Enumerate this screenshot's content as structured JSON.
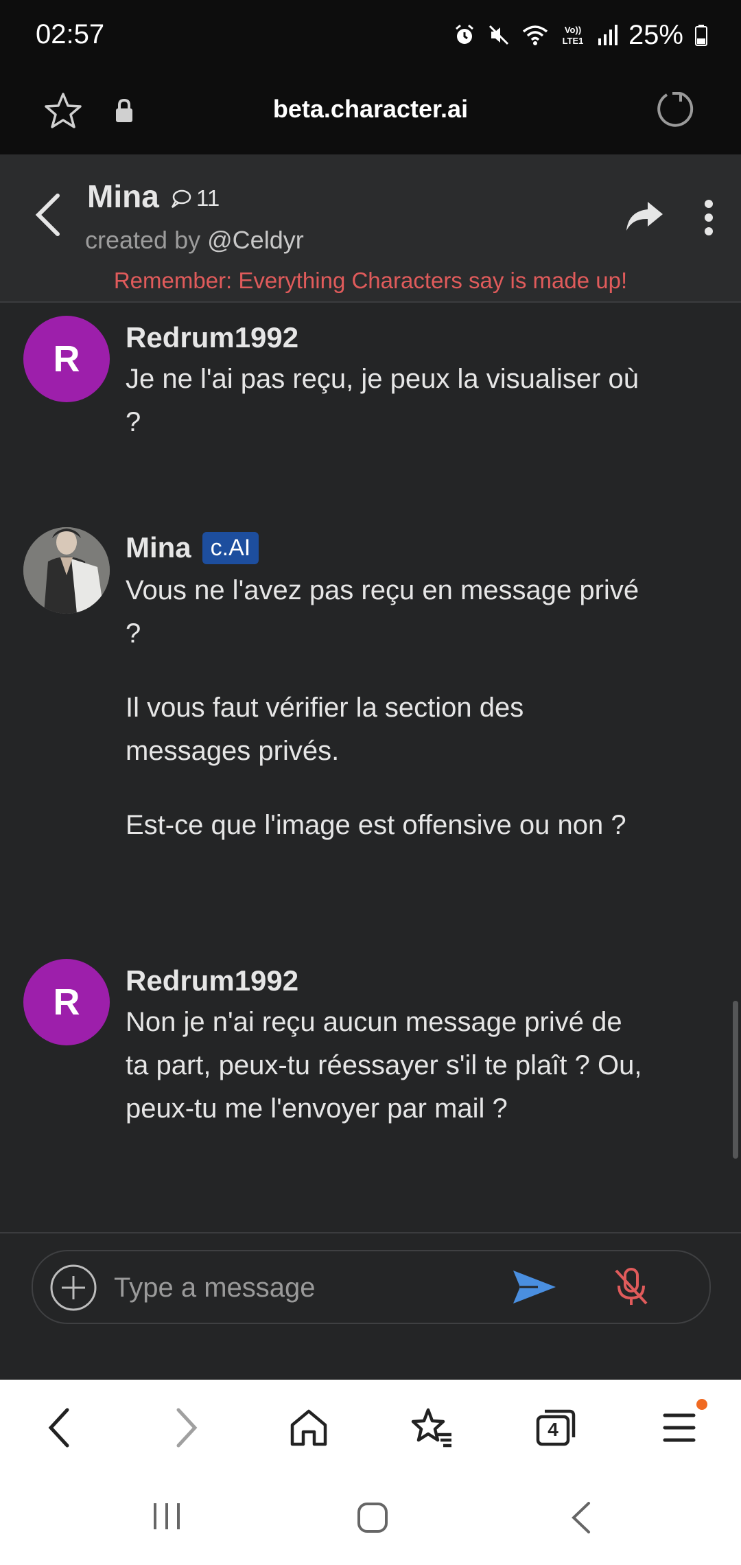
{
  "status_bar": {
    "time": "02:57",
    "battery": "25%",
    "icons": [
      "alarm-icon",
      "mute-icon",
      "wifi-icon",
      "volte-icon",
      "signal-icon",
      "battery-icon"
    ]
  },
  "browser": {
    "url": "beta.character.ai",
    "tab_count": "4"
  },
  "header": {
    "name": "Mina",
    "chat_count": "11",
    "created_by_prefix": "created by",
    "creator": "@Celdyr",
    "disclaimer": "Remember: Everything Characters say is made up!"
  },
  "messages": [
    {
      "author": "Redrum1992",
      "avatar_letter": "R",
      "paragraphs": [
        "Je ne l'ai pas reçu, je peux la visualiser où ?"
      ]
    },
    {
      "author": "Mina",
      "badge": "c.AI",
      "paragraphs": [
        "Vous ne l'avez pas reçu en message privé ?",
        "Il vous faut vérifier la section des messages privés.",
        "Est-ce que l'image est offensive ou non ?"
      ]
    },
    {
      "author": "Redrum1992",
      "avatar_letter": "R",
      "paragraphs": [
        "Non je n'ai reçu aucun message privé de ta part, peux-tu réessayer s'il te plaît ? Ou, peux-tu me l'envoyer par mail ?"
      ]
    }
  ],
  "composer": {
    "placeholder": "Type a message"
  },
  "colors": {
    "avatar_purple": "#9d1fab",
    "disclaimer_red": "#e05b5b",
    "badge_blue": "#1d4e9e",
    "send_blue": "#4a8fe0",
    "mic_red": "#e05b5b"
  }
}
